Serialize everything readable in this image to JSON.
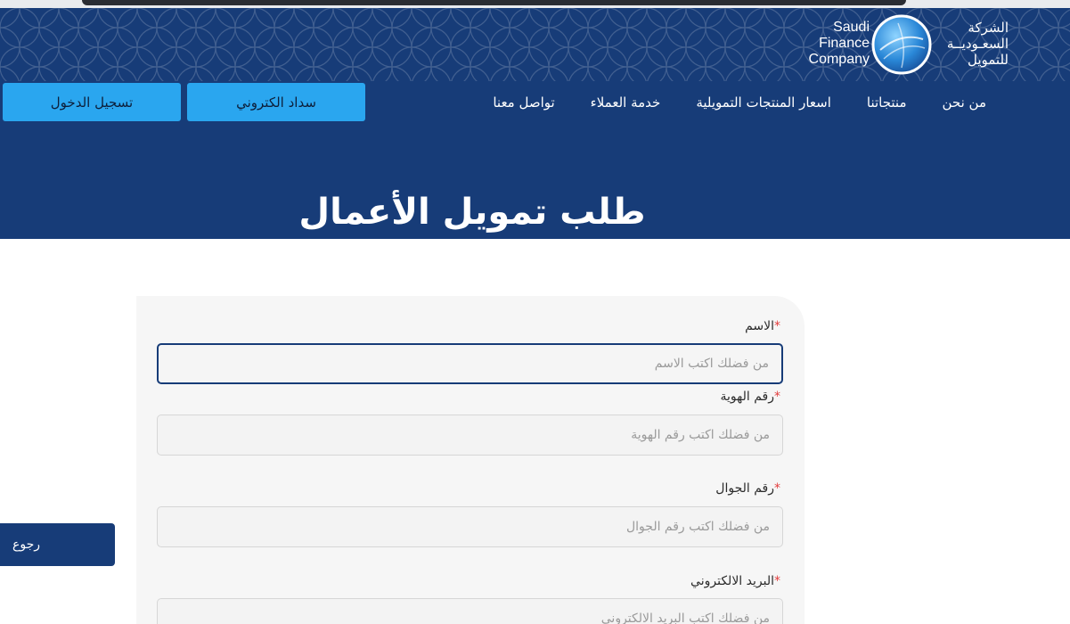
{
  "logo": {
    "en_lines": [
      "Saudi",
      "Finance",
      "Company"
    ],
    "ar_lines": [
      "الشركة",
      "السعـوديــة",
      "للتمويل"
    ]
  },
  "nav": {
    "items": [
      "من نحن",
      "منتجاتنا",
      "اسعار المنتجات التمويلية",
      "خدمة العملاء",
      "تواصل معنا"
    ]
  },
  "buttons": {
    "pay": "سداد الكتروني",
    "login": "تسجيل الدخول",
    "back": "رجوع"
  },
  "page": {
    "title": "طلب تمويل الأعمال"
  },
  "form": {
    "required_mark": "*",
    "fields": [
      {
        "label": "الاسم",
        "placeholder": "من فضلك اكتب الاسم",
        "value": ""
      },
      {
        "label": "رقم الهوية",
        "placeholder": "من فضلك اكتب رقم الهوية",
        "value": ""
      },
      {
        "label": "رقم الجوال",
        "placeholder": "من فضلك اكتب رقم الجوال",
        "value": ""
      },
      {
        "label": "البريد الالكتروني",
        "placeholder": "من فضلك اكتب البريد الالكتروني",
        "value": ""
      }
    ]
  },
  "colors": {
    "header_bg": "#173c78",
    "accent_button": "#2aa6ef",
    "required": "#e33d3d"
  }
}
